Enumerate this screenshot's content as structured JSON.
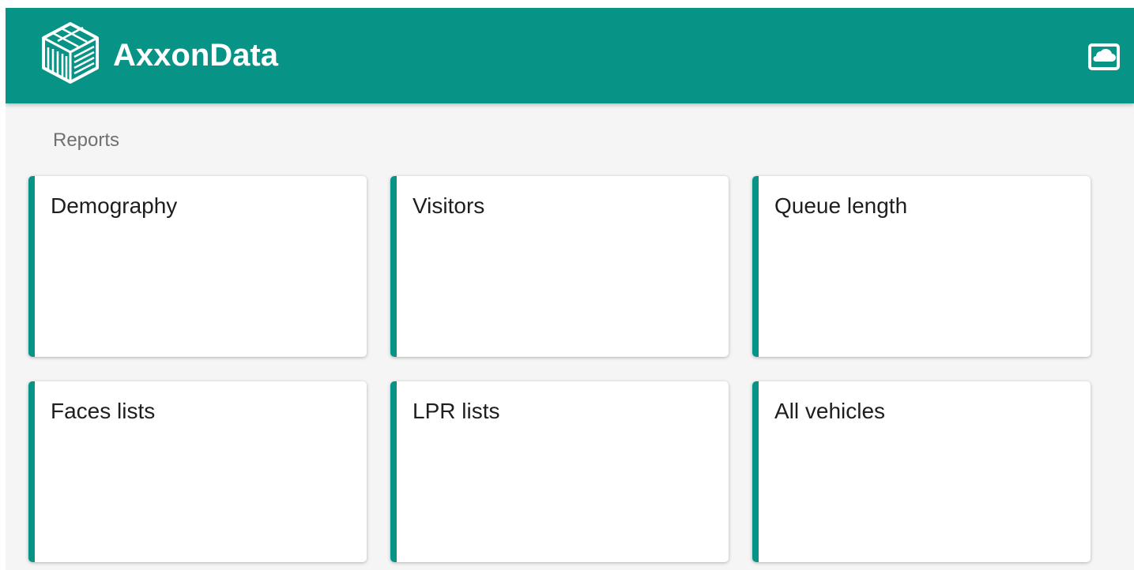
{
  "header": {
    "brand": "AxxonData",
    "logo_icon": "cube-logo-icon",
    "cloud_icon": "cloud-icon",
    "background_color": "#079486"
  },
  "breadcrumb": {
    "title": "Reports"
  },
  "reports": [
    {
      "label": "Demography"
    },
    {
      "label": "Visitors"
    },
    {
      "label": "Queue length"
    },
    {
      "label": "Faces lists"
    },
    {
      "label": "LPR lists"
    },
    {
      "label": "All vehicles"
    }
  ],
  "colors": {
    "accent": "#079486",
    "page_background": "#f5f5f5",
    "card_background": "#ffffff",
    "section_title": "#707070",
    "card_title": "#1e1e1e"
  }
}
